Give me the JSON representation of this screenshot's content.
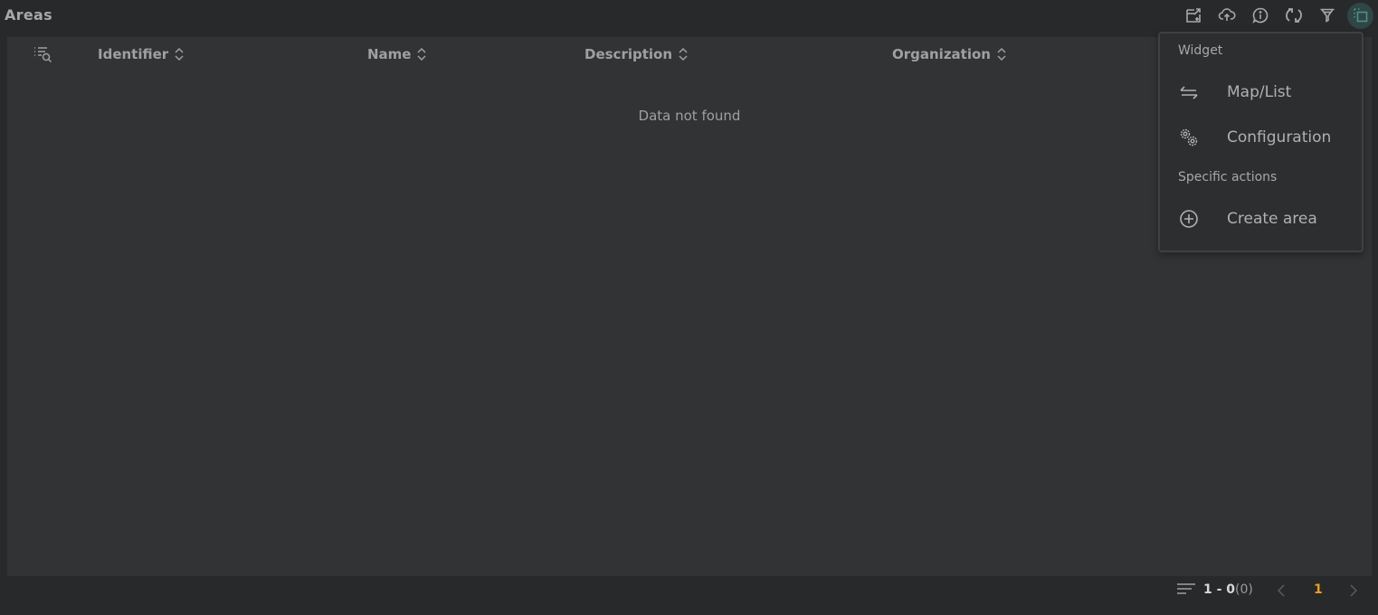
{
  "header": {
    "title": "Areas",
    "toolbar": [
      {
        "icon": "export-icon",
        "label": "Export"
      },
      {
        "icon": "upload-cloud-icon",
        "label": "Upload"
      },
      {
        "icon": "info-icon",
        "label": "Info"
      },
      {
        "icon": "refresh-icon",
        "label": "Refresh"
      },
      {
        "icon": "filter-icon",
        "label": "Filter"
      },
      {
        "icon": "widget-menu-icon",
        "label": "Widget menu",
        "active": true
      }
    ]
  },
  "table": {
    "columns": [
      {
        "label": "Identifier",
        "sortable": true
      },
      {
        "label": "Name",
        "sortable": true
      },
      {
        "label": "Description",
        "sortable": true
      },
      {
        "label": "Organization",
        "sortable": true
      }
    ],
    "rows": [],
    "empty_message": "Data not found"
  },
  "menu": {
    "sections": [
      {
        "title": "Widget",
        "items": [
          {
            "icon": "swap-arrows-icon",
            "label": "Map/List"
          },
          {
            "icon": "gears-icon",
            "label": "Configuration"
          }
        ]
      },
      {
        "title": "Specific actions",
        "items": [
          {
            "icon": "plus-circle-icon",
            "label": "Create area"
          }
        ]
      }
    ]
  },
  "pagination": {
    "range": "1 - 0",
    "total": "(0)",
    "current_page": "1"
  },
  "colors": {
    "accent": "#e8a020",
    "active_button_bg": "#2f4645",
    "active_icon": "#4e8f88",
    "panel_bg": "#323335",
    "page_bg": "#28292b"
  }
}
